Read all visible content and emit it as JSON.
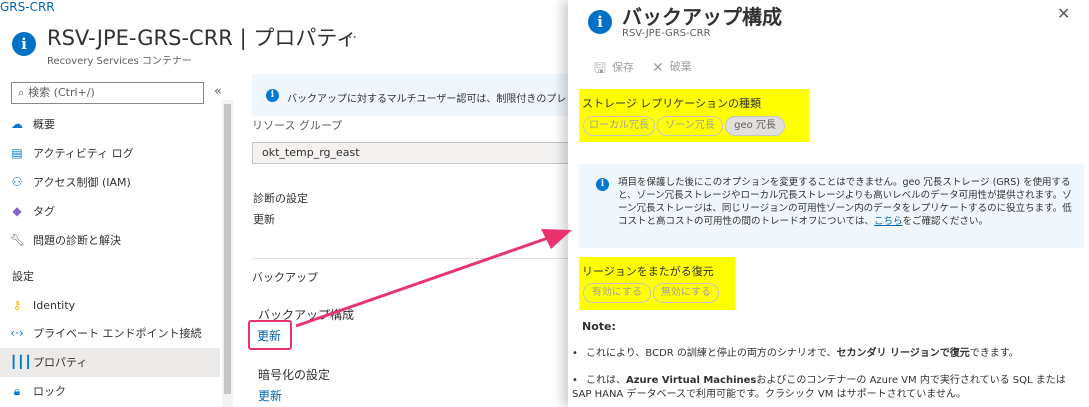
{
  "breadcrumb": "GRS-CRR",
  "header": {
    "title": "RSV-JPE-GRS-CRR | プロパティ",
    "subtitle": "Recovery Services コンテナー",
    "more": "…"
  },
  "sidebar": {
    "search_placeholder": "検索 (Ctrl+/)",
    "collapse": "«",
    "items": [
      {
        "label": "概要",
        "icon": "cloud-icon"
      },
      {
        "label": "アクティビティ ログ",
        "icon": "log-icon"
      },
      {
        "label": "アクセス制御 (IAM)",
        "icon": "iam-icon"
      },
      {
        "label": "タグ",
        "icon": "tag-icon"
      },
      {
        "label": "問題の診断と解決",
        "icon": "wrench-icon"
      }
    ],
    "section_settings": "設定",
    "settings_items": [
      {
        "label": "Identity",
        "icon": "key-icon"
      },
      {
        "label": "プライベート エンドポイント接続",
        "icon": "endpoint-icon"
      },
      {
        "label": "プロパティ",
        "icon": "properties-icon"
      },
      {
        "label": "ロック",
        "icon": "lock-icon"
      }
    ]
  },
  "main": {
    "banner": "バックアップに対するマルチユーザー認可は、制限付きのプレビュー版で",
    "rg_label": "リソース グループ",
    "rg_value": "okt_temp_rg_east",
    "diag_label": "診断の設定",
    "diag_update": "更新",
    "backup_section": "バックアップ",
    "backup_config_label": "バックアップ構成",
    "backup_config_update": "更新",
    "encryption_label": "暗号化の設定",
    "encryption_update": "更新"
  },
  "panel": {
    "title": "バックアップ構成",
    "subtitle": "RSV-JPE-GRS-CRR",
    "close": "✕",
    "save": "保存",
    "discard": "破棄",
    "replication_label": "ストレージ レプリケーションの種類",
    "replication_options": [
      "ローカル冗長",
      "ゾーン冗長",
      "geo 冗長"
    ],
    "replication_selected": "geo 冗長",
    "info_text_before_link": "項目を保護した後にこのオプションを変更することはできません。geo 冗長ストレージ (GRS) を使用すると、ゾーン冗長ストレージやローカル冗長ストレージよりも高いレベルのデータ可用性が提供されます。ゾーン冗長ストレージは、同じリージョンの可用性ゾーン内のデータをレプリケートするのに役立ちます。低コストと高コストの可用性の間のトレードオフについては、",
    "info_link": "こちら",
    "info_text_after_link": "をご確認ください。",
    "crr_label": "リージョンをまたがる復元",
    "crr_options": [
      "有効にする",
      "無効にする"
    ],
    "note_label": "Note:",
    "bullet1_a": "これにより、BCDR の訓練と停止の両方のシナリオで、",
    "bullet1_b": "セカンダリ リージョンで復元",
    "bullet1_c": "できます。",
    "bullet2_a": "これは、",
    "bullet2_b": "Azure Virtual Machines",
    "bullet2_c": "およびこのコンテナーの Azure VM 内で実行されている SQL または SAP HANA データベースで利用可能です。クラシック VM はサポートされていません。"
  },
  "colors": {
    "accent": "#0078d4",
    "highlight_yellow": "#ffff00",
    "arrow_pink": "#e8336f"
  }
}
